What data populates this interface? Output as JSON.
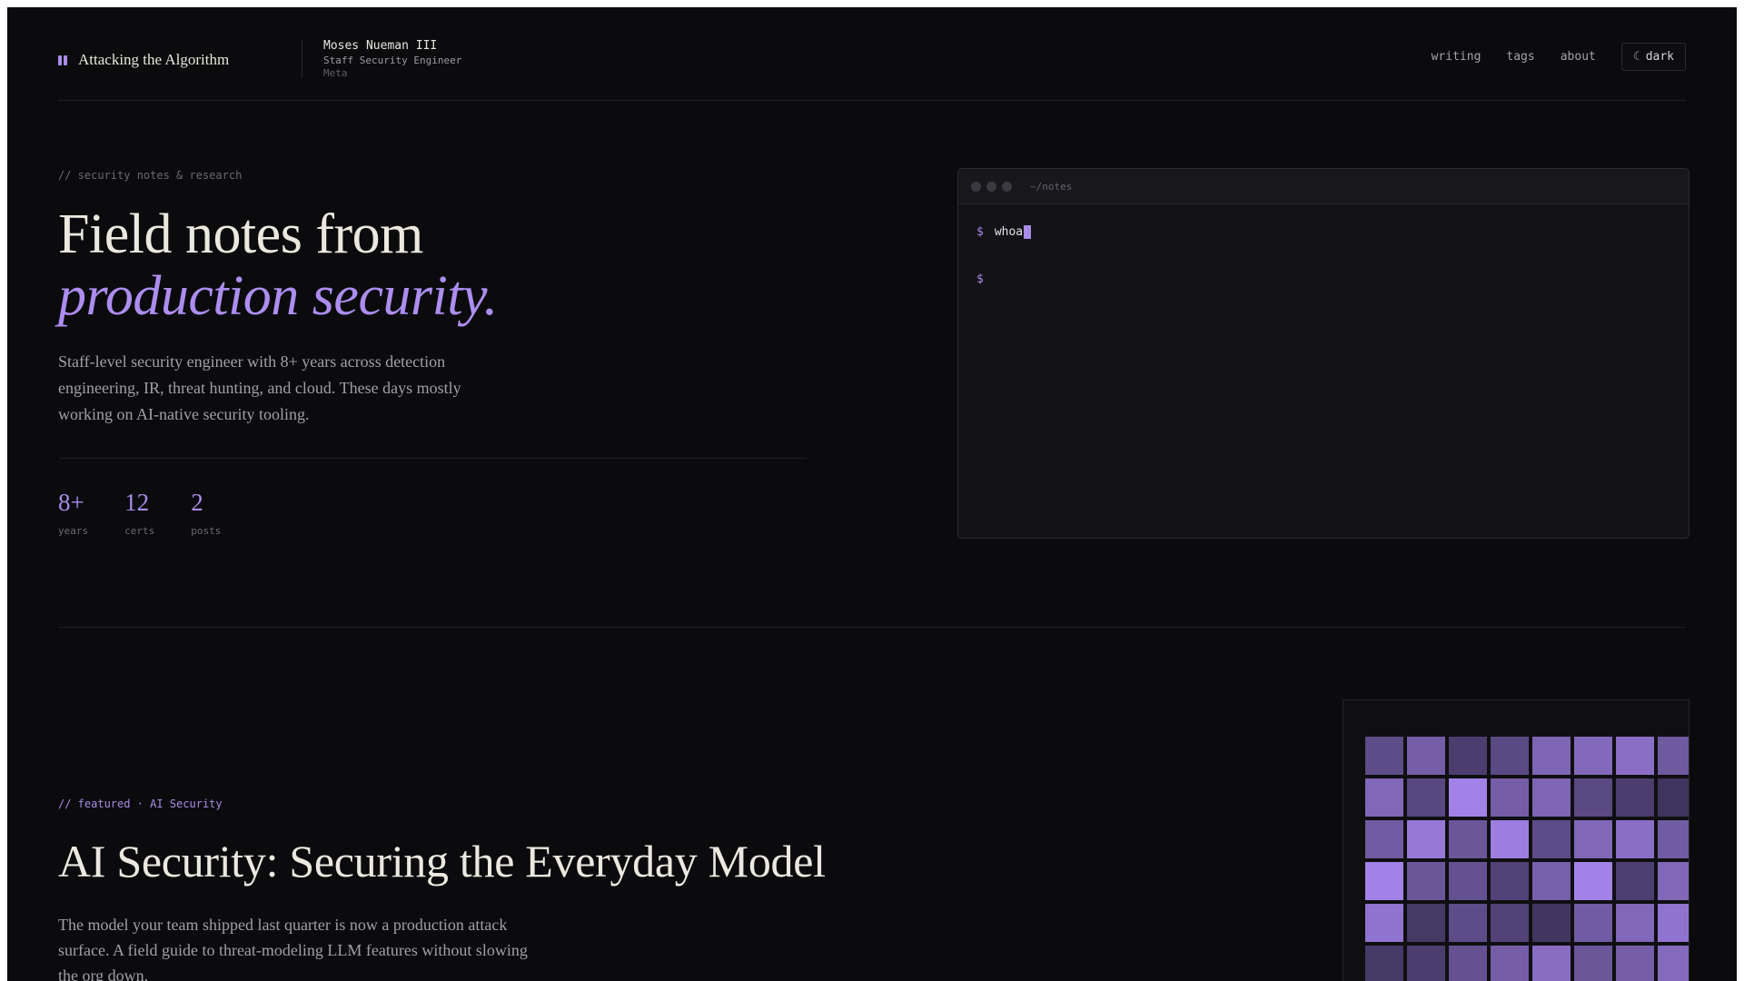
{
  "header": {
    "brand_title": "Attacking the Algorithm",
    "author_name": "Moses Nueman III",
    "author_role": "Staff Security Engineer",
    "author_org": "Meta",
    "nav": [
      "writing",
      "tags",
      "about"
    ],
    "theme_icon": "☾",
    "theme_label": "dark"
  },
  "hero": {
    "eyebrow": "// security notes & research",
    "title_line1": "Field notes from",
    "title_line2": "production security.",
    "description": "Staff-level security engineer with 8+ years across detection engineering, IR, threat hunting, and cloud. These days mostly working on AI-native security tooling.",
    "stats": [
      {
        "value": "8+",
        "label": "years"
      },
      {
        "value": "12",
        "label": "certs"
      },
      {
        "value": "2",
        "label": "posts"
      }
    ]
  },
  "terminal": {
    "path": "~/notes",
    "prompt": "$",
    "lines": [
      {
        "prompt": "$",
        "command": "whoa"
      },
      {
        "prompt": "$",
        "command": ""
      }
    ]
  },
  "featured": {
    "eyebrow": "// featured · AI Security",
    "title": "AI Security: Securing the Everyday Model",
    "description": "The model your team shipped last quarter is now a production attack surface. A field guide to threat-modeling LLM features without slowing the org down."
  },
  "art_grid": {
    "accent": "#a98be8",
    "levels": [
      [
        0.45,
        0.62,
        0.3,
        0.42,
        0.7,
        0.74,
        0.8,
        0.58
      ],
      [
        0.72,
        0.4,
        1.0,
        0.62,
        0.7,
        0.42,
        0.3,
        0.2
      ],
      [
        0.6,
        0.9,
        0.55,
        0.95,
        0.45,
        0.72,
        0.8,
        0.6
      ],
      [
        1.0,
        0.55,
        0.5,
        0.35,
        0.65,
        1.0,
        0.32,
        0.72
      ],
      [
        0.85,
        0.25,
        0.45,
        0.35,
        0.22,
        0.6,
        0.72,
        0.85
      ],
      [
        0.25,
        0.3,
        0.5,
        0.62,
        0.78,
        0.55,
        0.62,
        0.75
      ]
    ]
  }
}
